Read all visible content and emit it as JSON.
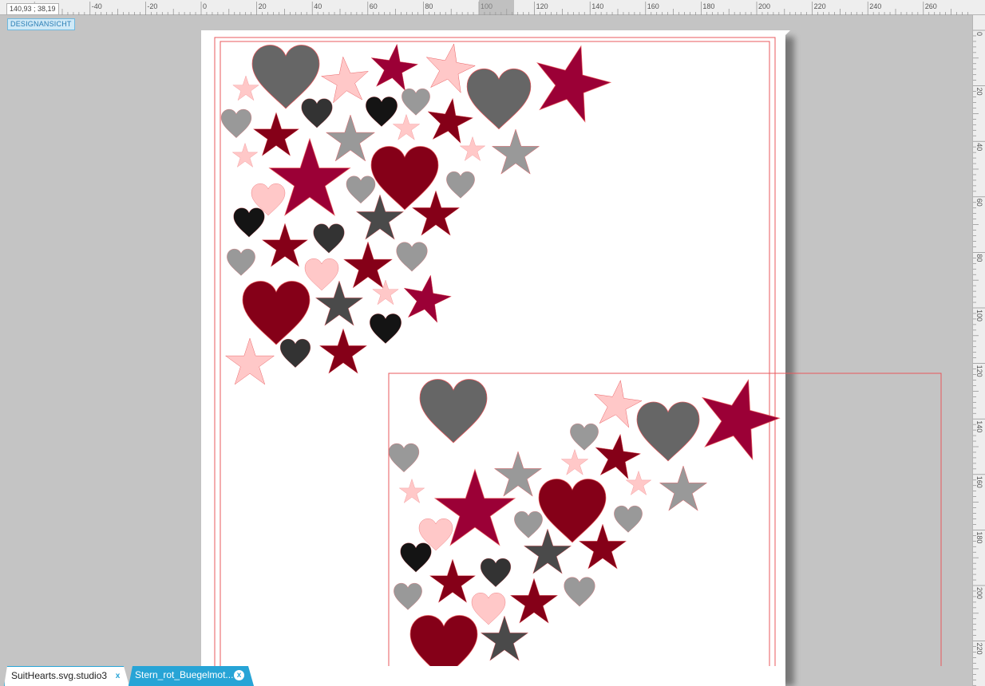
{
  "ruler": {
    "coord_readout": "140,93 ; 38,19",
    "top_labels": [
      "-40",
      "-20",
      "0",
      "20",
      "40",
      "60",
      "80",
      "100",
      "120",
      "140",
      "160",
      "180",
      "200",
      "220",
      "240",
      "260"
    ],
    "right_labels": [
      "0",
      "20",
      "40",
      "60",
      "80",
      "100",
      "120",
      "140",
      "160",
      "180",
      "200",
      "220"
    ]
  },
  "view": {
    "badge_label": "DESIGNANSICHT"
  },
  "tabs": [
    {
      "label": "SuitHearts.svg.studio3",
      "close": "x",
      "active": false
    },
    {
      "label": "Stern_rot_Buegelmot...",
      "close": "x",
      "active": true
    }
  ],
  "colors": {
    "canvas": "#c4c4c4",
    "outline": "#e8585c",
    "crimson": "#9b0036",
    "dark_red": "#850018",
    "pink": "#ffc8c8",
    "gray_dark": "#666666",
    "gray_light": "#999999",
    "charcoal": "#333333",
    "black": "#141414",
    "star_dark_gray": "#4a4a4a",
    "tab_blue": "#27a4d6"
  }
}
